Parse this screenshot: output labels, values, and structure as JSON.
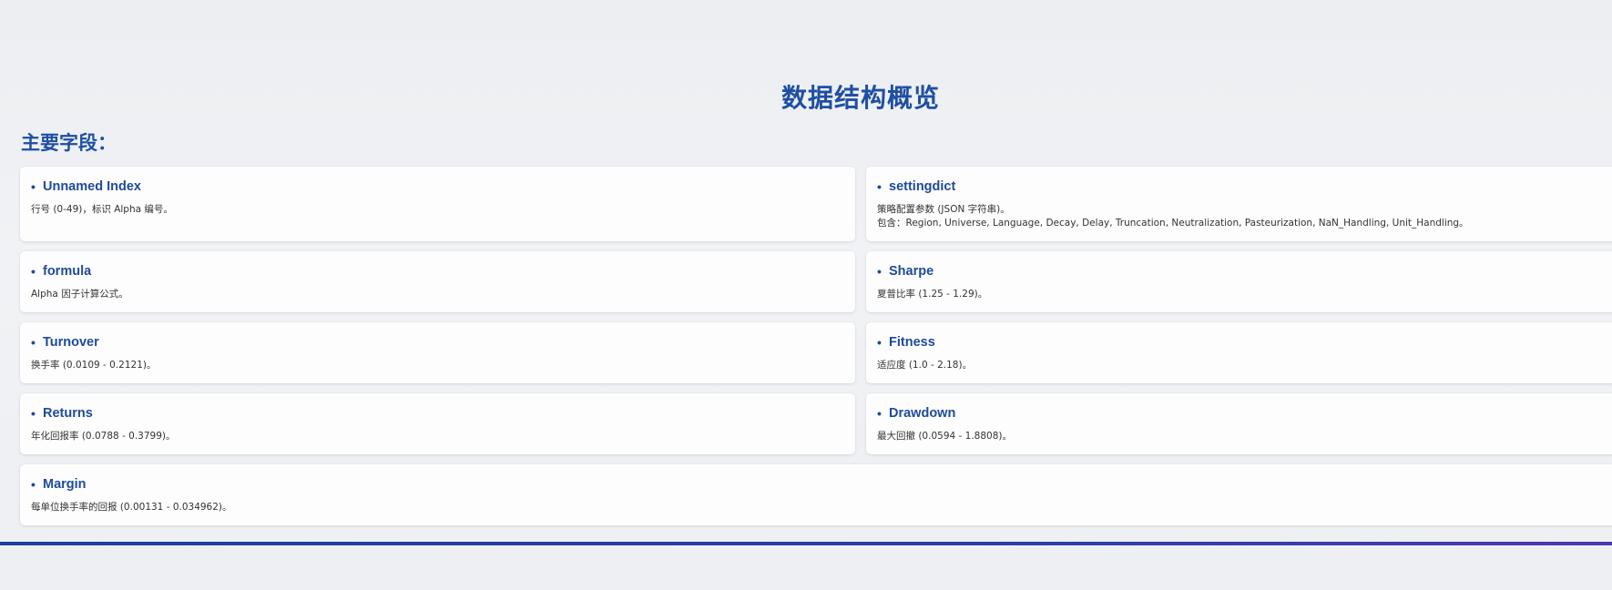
{
  "page": {
    "title": "数据结构概览",
    "section_heading": "主要字段："
  },
  "fields": [
    {
      "name": "Unnamed Index",
      "desc": "行号 (0-49)，标识 Alpha 编号。",
      "desc2": ""
    },
    {
      "name": "settingdict",
      "desc": "策略配置参数 (JSON 字符串)。",
      "desc2": "包含：Region, Universe, Language, Decay, Delay, Truncation, Neutralization, Pasteurization, NaN_Handling, Unit_Handling。"
    },
    {
      "name": "formula",
      "desc": "Alpha 因子计算公式。",
      "desc2": ""
    },
    {
      "name": "Sharpe",
      "desc": "夏普比率 (1.25 - 1.29)。",
      "desc2": ""
    },
    {
      "name": "Turnover",
      "desc": "换手率 (0.0109 - 0.2121)。",
      "desc2": ""
    },
    {
      "name": "Fitness",
      "desc": "适应度 (1.0 - 2.18)。",
      "desc2": ""
    },
    {
      "name": "Returns",
      "desc": "年化回报率 (0.0788 - 0.3799)。",
      "desc2": ""
    },
    {
      "name": "Drawdown",
      "desc": "最大回撤 (0.0594 - 1.8808)。",
      "desc2": ""
    },
    {
      "name": "Margin",
      "desc": "每单位换手率的回报 (0.00131 - 0.034962)。",
      "desc2": ""
    }
  ],
  "bullet_char": "•",
  "colors": {
    "accent": "#1f4fa3",
    "rule_start": "#1f3f9f",
    "rule_end": "#4b3ab0"
  }
}
